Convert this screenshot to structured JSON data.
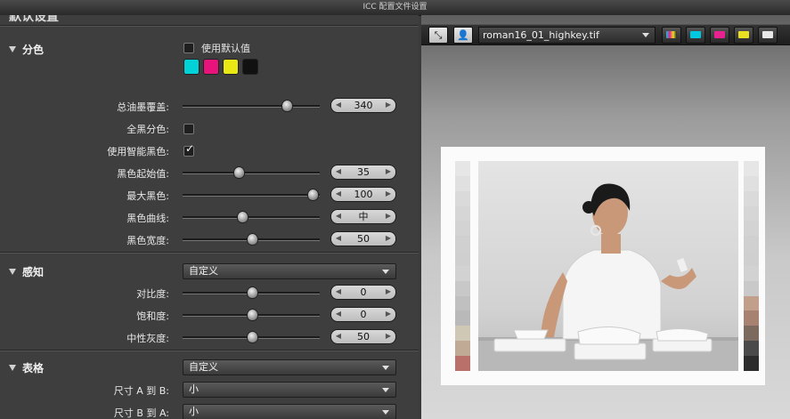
{
  "window": {
    "title": "ICC 配置文件设置"
  },
  "left_panel": {
    "top_title": "默认设置",
    "separation": {
      "title": "分色",
      "use_defaults_label": "使用默认值",
      "inks": [
        "#00d2d8",
        "#e8147c",
        "#e8e814",
        "#111111"
      ],
      "rows": [
        {
          "label": "总油墨覆盖:",
          "value": "340",
          "level": 0.75
        },
        {
          "label": "最大黑色:",
          "value": "100",
          "level": 0.94
        },
        {
          "label": "黑色起始值:",
          "value": "35",
          "level": 0.4
        },
        {
          "label": "黑色曲线:",
          "value": "中",
          "level": 0.43
        },
        {
          "label": "黑色宽度:",
          "value": "50",
          "level": 0.5
        }
      ],
      "full_black_label": "全黑分色:",
      "smart_black_label": "使用智能黑色:",
      "smart_black_checked": true
    },
    "perception": {
      "title": "感知",
      "mode": "自定义",
      "rows": [
        {
          "label": "对比度:",
          "value": "0",
          "level": 0.5
        },
        {
          "label": "饱和度:",
          "value": "0",
          "level": 0.5
        },
        {
          "label": "中性灰度:",
          "value": "50",
          "level": 0.5
        }
      ]
    },
    "table": {
      "title": "表格",
      "mode": "自定义",
      "size_a_to_b_label": "尺寸 A 到 B:",
      "size_a_to_b_value": "小",
      "size_b_to_a_label": "尺寸 B 到 A:",
      "size_b_to_a_value": "小"
    }
  },
  "preview": {
    "file_name": "roman16_01_highkey.tif",
    "tb_fit": "⤡",
    "tb_person": "👤",
    "channel_chips": [
      "#ffffff",
      "#00c8e0",
      "#e82090",
      "#e8e020",
      "#e8e8e8"
    ],
    "left_strip": [
      "#e6e6e6",
      "#e0e0e0",
      "#dadada",
      "#d6d6d6",
      "#d3d3d3",
      "#d0d0d0",
      "#cfcfcf",
      "#d2d2d2",
      "#c8c8c8",
      "#c0c0c0",
      "#b9b9b9",
      "#cfc8b4",
      "#c0aa96",
      "#b9706a"
    ],
    "right_strip": [
      "#e6e6e6",
      "#e0e0e0",
      "#dadada",
      "#d6d6d6",
      "#d3d3d3",
      "#d0d0d0",
      "#cfcfcf",
      "#d2d2d2",
      "#c9c9c9",
      "#c29f8a",
      "#a88271",
      "#7c6a5e",
      "#4a4a4a",
      "#2c2c2c"
    ]
  }
}
